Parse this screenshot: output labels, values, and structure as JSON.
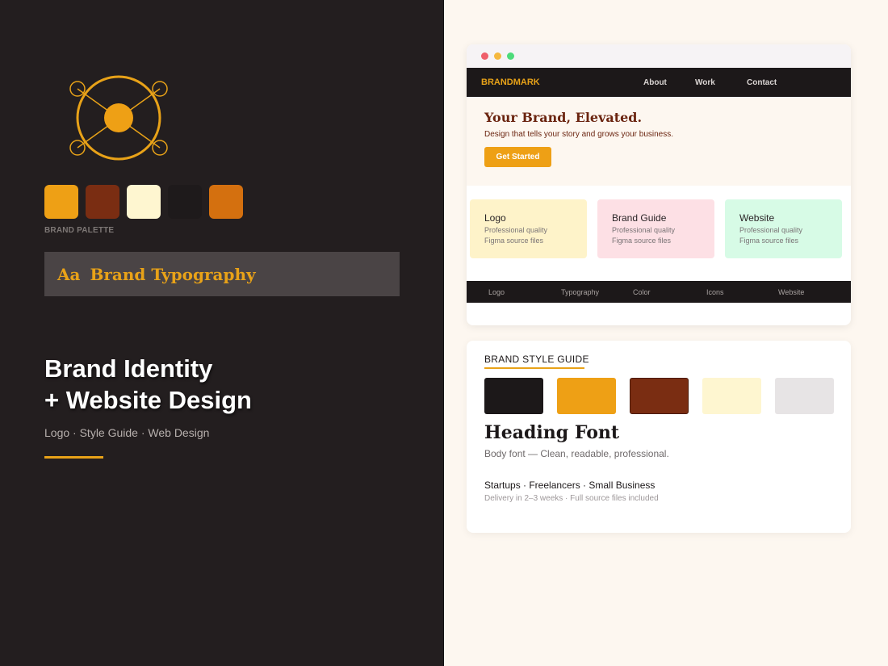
{
  "palette": {
    "label": "BRAND PALETTE",
    "swatches": [
      "#eea015",
      "#7a2d12",
      "#fef6d0",
      "#1e1a1b",
      "#d4700f"
    ]
  },
  "typography": {
    "aa": "Aa",
    "label": "Brand Typography"
  },
  "hero": {
    "line1": "Brand Identity",
    "line2": "+ Website Design",
    "services": "Logo · Style Guide · Web Design"
  },
  "browser": {
    "dots": [
      "#ef5f6b",
      "#f5b83e",
      "#4ddb7a"
    ],
    "brand": "BRANDMARK",
    "nav": [
      "About",
      "Work",
      "Contact"
    ],
    "hero_title": "Your Brand, Elevated.",
    "hero_subtitle": "Design that tells your story and grows your business.",
    "cta_label": "Get Started",
    "cards": [
      {
        "title": "Logo",
        "lines": [
          "Professional quality",
          "Figma source files"
        ],
        "bg": "#fef3c9"
      },
      {
        "title": "Brand Guide",
        "lines": [
          "Professional quality",
          "Figma source files"
        ],
        "bg": "#fde0e5"
      },
      {
        "title": "Website",
        "lines": [
          "Professional quality",
          "Figma source files"
        ],
        "bg": "#d7fbe6"
      }
    ],
    "footer_links": [
      "Logo",
      "Typography",
      "Color",
      "Icons",
      "Website"
    ]
  },
  "style_guide": {
    "title": "BRAND STYLE GUIDE",
    "swatches": [
      "#1c1819",
      "#eea015",
      "#7a2d12",
      "#fef6d0",
      "#e7e4e5"
    ],
    "heading_font": "Heading Font",
    "body_font": "Body font — Clean, readable, professional.",
    "audience": "Startups · Freelancers · Small Business",
    "delivery": "Delivery in 2–3 weeks · Full source files included"
  },
  "colors": {
    "accent": "#e8a218",
    "dark": "#231e1f",
    "brown": "#6b2510"
  },
  "icons": [
    "brand-logo-icon"
  ]
}
